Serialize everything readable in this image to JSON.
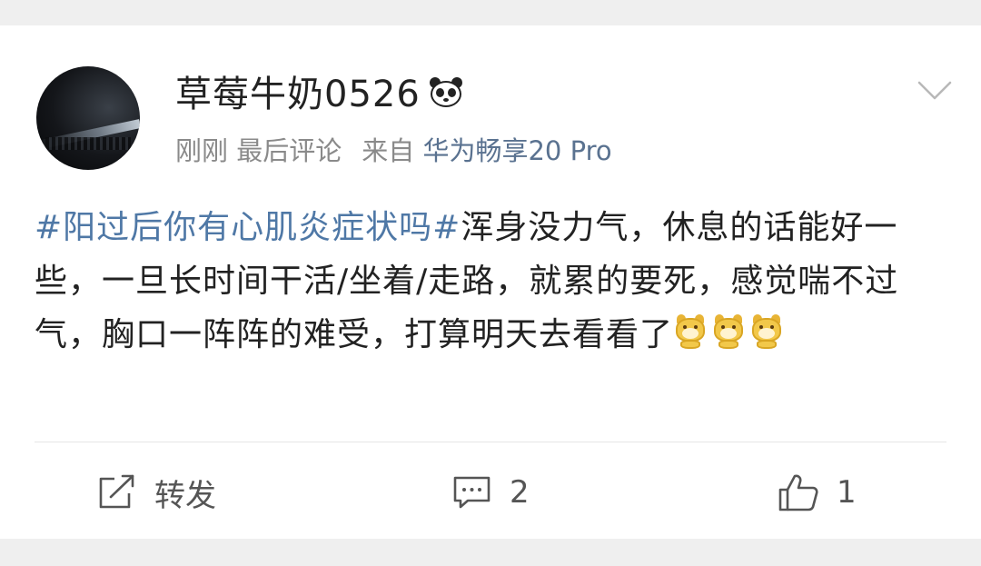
{
  "post": {
    "username": "草莓牛奶0526",
    "badge_icon": "panda-icon",
    "meta": {
      "time": "刚刚",
      "last_comment": "最后评论",
      "source_prefix": "来自",
      "device": "华为畅享20 Pro"
    },
    "content": {
      "topic": "#阳过后你有心肌炎症状吗#",
      "text": "浑身没力气，休息的话能好一些，一旦长时间干活/坐着/走路，就累的要死，感觉喘不过气，胸口一阵阵的难受，打算明天去看看了",
      "emoji_count": 3,
      "emoji_icon": "dog-sticker-emoji"
    }
  },
  "actions": {
    "repost_label": "转发",
    "comment_count": "2",
    "like_count": "1"
  },
  "colors": {
    "topic_link": "#4f78a6",
    "device_link": "#5a7290",
    "meta_gray": "#8a8a8a",
    "text": "#222222"
  }
}
